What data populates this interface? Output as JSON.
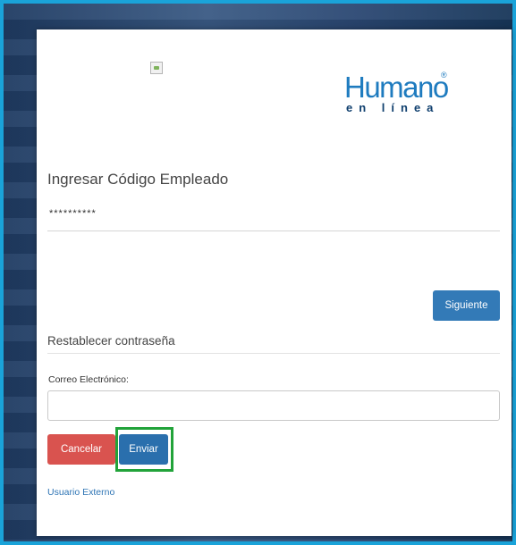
{
  "brand": {
    "logo_main": "Humano",
    "logo_registered": "®",
    "logo_sub": "en línea",
    "color": "#1e7bbf"
  },
  "login": {
    "code_label": "Ingresar Código Empleado",
    "code_value": "**********",
    "next_button": "Siguiente"
  },
  "reset": {
    "title": "Restablecer contraseña",
    "email_label": "Correo Electrónico:",
    "email_value": "",
    "cancel_button": "Cancelar",
    "send_button": "Enviar"
  },
  "links": {
    "external_user": "Usuario Externo"
  },
  "colors": {
    "primary": "#337ab7",
    "danger": "#d9534f",
    "highlight": "#22a33a",
    "frame": "#1aa3d9"
  }
}
